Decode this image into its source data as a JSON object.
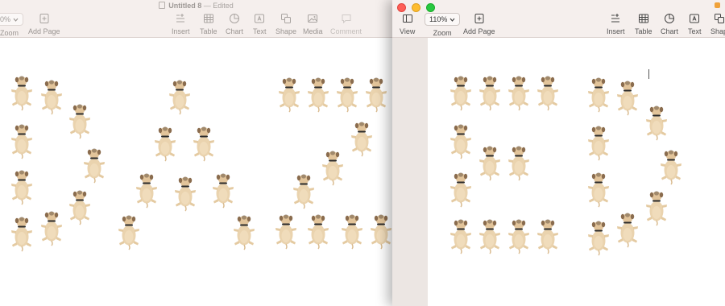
{
  "back_window": {
    "title": "Untitled 8",
    "title_separator": "—",
    "title_status": "Edited",
    "zoom_value": "0%",
    "toolbar": {
      "zoom": "Zoom",
      "add_page": "Add Page",
      "insert": "Insert",
      "table": "Table",
      "chart": "Chart",
      "text": "Text",
      "shape": "Shape",
      "media": "Media",
      "comment": "Comment"
    }
  },
  "front_window": {
    "zoom_value": "110%",
    "toolbar": {
      "view": "View",
      "zoom": "Zoom",
      "add_page": "Add Page",
      "insert": "Insert",
      "table": "Table",
      "chart": "Chart",
      "text": "Text",
      "shape": "Shap"
    }
  },
  "image_element": "pug-dog",
  "colors": {
    "toolbar_bg": "#f5efed",
    "sidebar_bg": "#ece6e3",
    "dog_body": "#ead3ae",
    "dog_collar": "#2a2a2a"
  }
}
